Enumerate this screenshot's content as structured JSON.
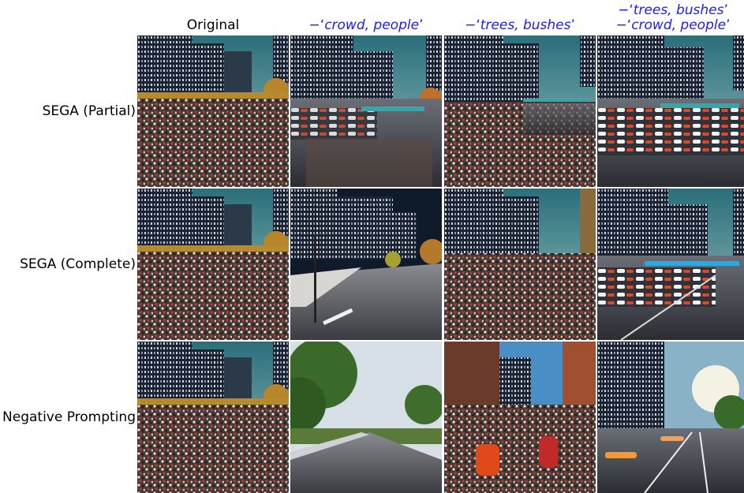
{
  "column_headers": [
    {
      "prefix": "",
      "text": "Original"
    },
    {
      "prefix": "−‘",
      "text": "crowd, people",
      "suffix": "’"
    },
    {
      "prefix": "−‘",
      "text": "trees, bushes",
      "suffix": "’"
    },
    {
      "lines": [
        {
          "prefix": "−‘",
          "text": "trees, bushes",
          "suffix": "’"
        },
        {
          "prefix": "−‘",
          "text": "crowd, people",
          "suffix": "’"
        }
      ]
    }
  ],
  "row_labels": [
    "SEGA (Partial)",
    "SEGA (Complete)",
    "Negative Prompting"
  ],
  "colors": {
    "negative_prompt_text": "#1a1aff"
  }
}
